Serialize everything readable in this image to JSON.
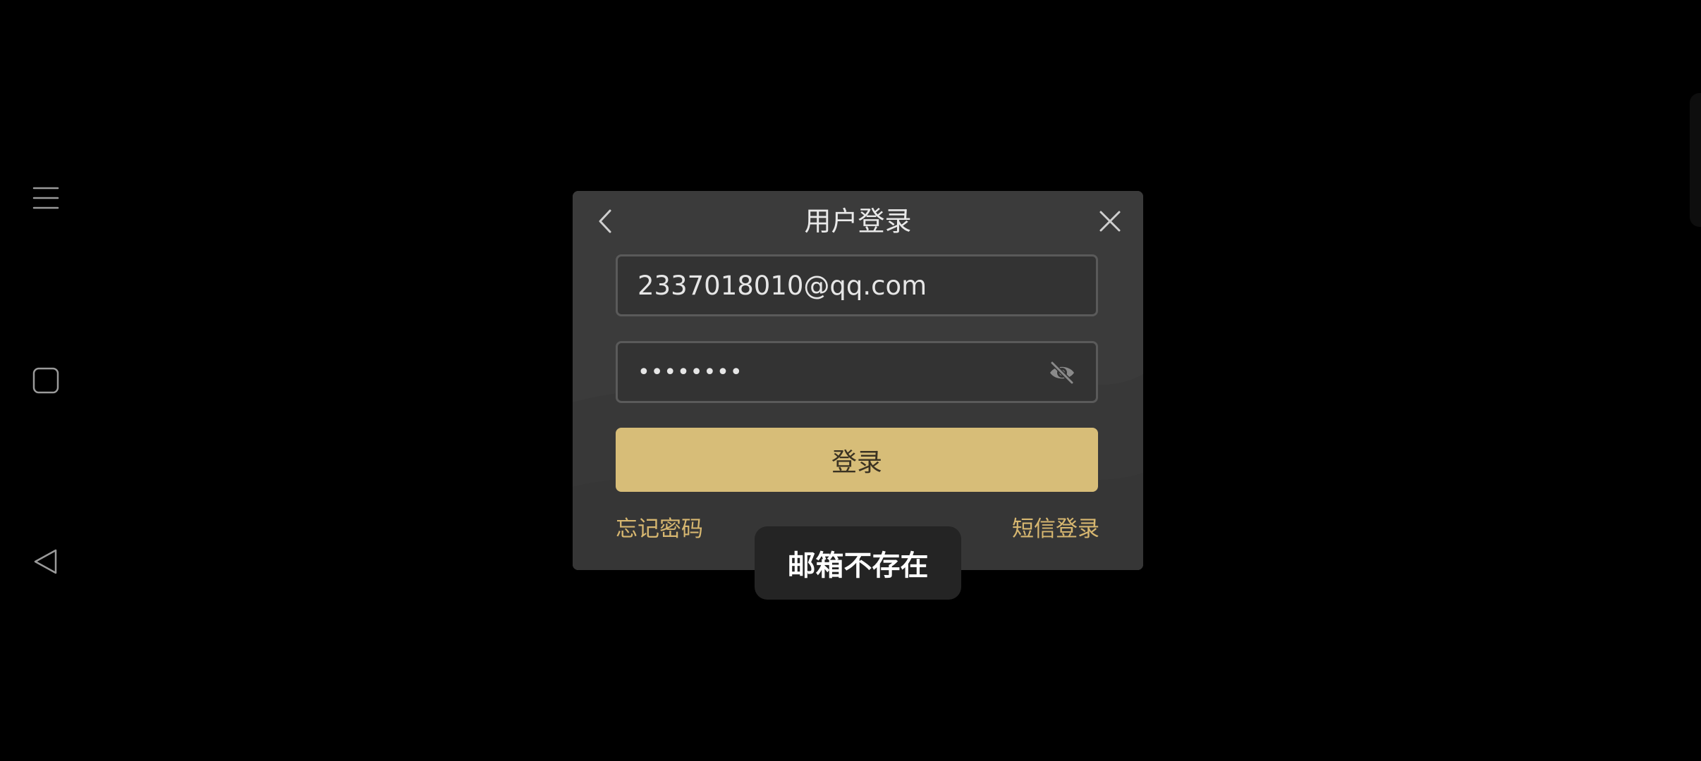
{
  "navbar": {
    "menu_icon": "menu-icon",
    "home_icon": "square-home-icon",
    "back_icon": "triangle-back-icon"
  },
  "dialog": {
    "title": "用户登录",
    "back_icon": "chevron-left-icon",
    "close_icon": "close-icon",
    "email": {
      "value": "2337018010@qq.com"
    },
    "password": {
      "value": "••••••••",
      "toggle_icon": "eye-off-icon"
    },
    "login_label": "登录",
    "forgot_password_label": "忘记密码",
    "sms_login_label": "短信登录"
  },
  "toast": {
    "message": "邮箱不存在"
  },
  "colors": {
    "background": "#000000",
    "dialog": "#3a3a3a",
    "accent": "#d7bd78",
    "link": "#d7b770",
    "toast": "#242424"
  }
}
